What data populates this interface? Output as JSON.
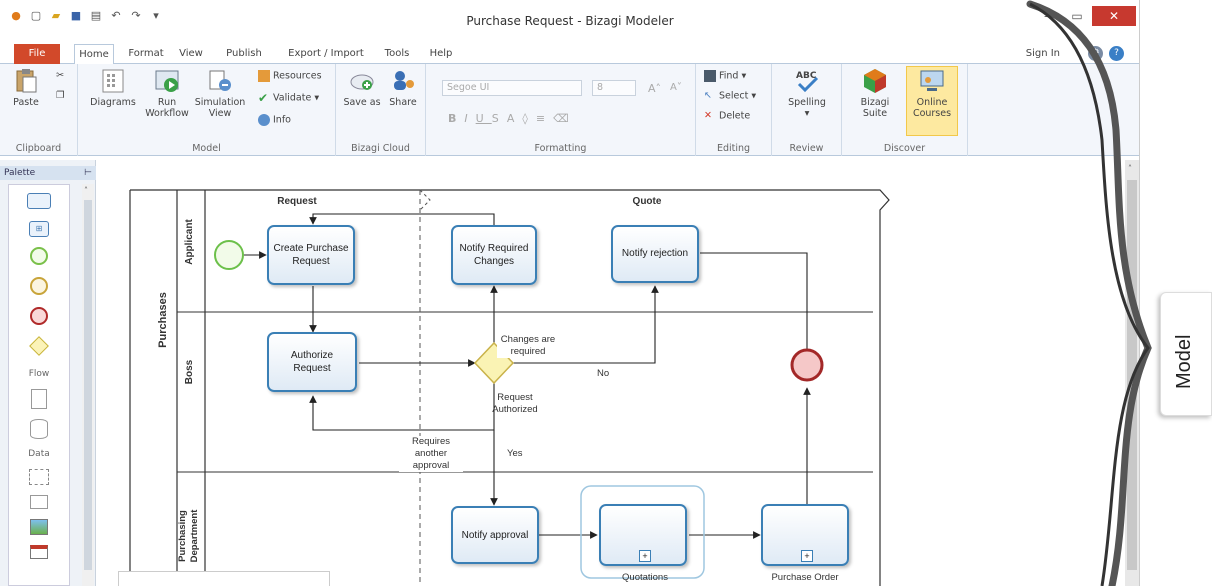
{
  "window": {
    "title": "Purchase Request - Bizagi Modeler"
  },
  "tabs": [
    {
      "label": "File"
    },
    {
      "label": "Home"
    },
    {
      "label": "Format"
    },
    {
      "label": "View"
    },
    {
      "label": "Publish"
    },
    {
      "label": "Export / Import"
    },
    {
      "label": "Tools"
    },
    {
      "label": "Help"
    }
  ],
  "header": {
    "sign_in": "Sign In"
  },
  "ribbon": {
    "clipboard": {
      "group": "Clipboard",
      "paste": "Paste"
    },
    "model": {
      "group": "Model",
      "diagrams": "Diagrams",
      "run_workflow": "Run Workflow",
      "simulation_view": "Simulation View",
      "resources": "Resources",
      "validate": "Validate",
      "info": "Info"
    },
    "cloud": {
      "group": "Bizagi Cloud",
      "save_as": "Save as",
      "share": "Share"
    },
    "formatting": {
      "group": "Formatting",
      "font": "Segoe UI",
      "size": "8"
    },
    "editing": {
      "group": "Editing",
      "find": "Find",
      "select": "Select",
      "delete": "Delete"
    },
    "review": {
      "group": "Review",
      "spelling": "Spelling"
    },
    "discover": {
      "group": "Discover",
      "bizagi_suite": "Bizagi Suite",
      "online_courses": "Online Courses"
    }
  },
  "palette": {
    "title": "Palette",
    "sections": [
      "Flow",
      "Data"
    ]
  },
  "diagram": {
    "pool": "Purchases",
    "lanes": [
      "Applicant",
      "Boss",
      "Purchasing Department"
    ],
    "phases": [
      "Request",
      "Quote"
    ],
    "tasks": {
      "create": "Create Purchase Request",
      "notify_changes": "Notify Required Changes",
      "notify_rejection": "Notify rejection",
      "authorize": "Authorize Request",
      "notify_approval": "Notify approval",
      "quotations": "Quotations",
      "purchase_order": "Purchase Order"
    },
    "gateway": "Request Authorized",
    "flow_labels": {
      "changes": "Changes are required",
      "no": "No",
      "yes": "Yes",
      "another": "Requires another approval"
    }
  },
  "annotation": {
    "label": "Model"
  },
  "colors": {
    "file_tab": "#d2492a",
    "task_border": "#3a7fb5",
    "start_event": "#6cc04a",
    "end_event": "#c0392b",
    "gateway": "#f2e488",
    "close": "#c7392f"
  }
}
